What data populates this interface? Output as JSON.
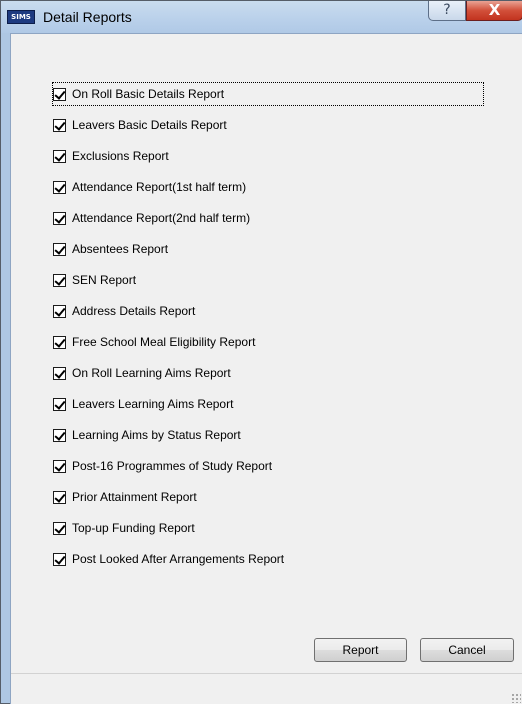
{
  "window": {
    "app_icon_text": "SIMS",
    "title": "Detail Reports",
    "help_glyph": "?",
    "close_glyph": "X"
  },
  "reports": [
    {
      "label": "On Roll Basic Details Report",
      "checked": true
    },
    {
      "label": "Leavers Basic Details Report",
      "checked": true
    },
    {
      "label": "Exclusions Report",
      "checked": true
    },
    {
      "label": "Attendance Report(1st half term)",
      "checked": true
    },
    {
      "label": "Attendance Report(2nd half term)",
      "checked": true
    },
    {
      "label": "Absentees Report",
      "checked": true
    },
    {
      "label": "SEN Report",
      "checked": true
    },
    {
      "label": "Address Details Report",
      "checked": true
    },
    {
      "label": "Free School Meal Eligibility Report",
      "checked": true
    },
    {
      "label": "On Roll Learning Aims Report",
      "checked": true
    },
    {
      "label": "Leavers Learning Aims Report",
      "checked": true
    },
    {
      "label": "Learning Aims by Status Report",
      "checked": true
    },
    {
      "label": "Post-16 Programmes of Study Report",
      "checked": true
    },
    {
      "label": "Prior Attainment Report",
      "checked": true
    },
    {
      "label": "Top-up Funding Report",
      "checked": true
    },
    {
      "label": "Post Looked After Arrangements Report",
      "checked": true
    }
  ],
  "buttons": {
    "report": "Report",
    "cancel": "Cancel"
  }
}
